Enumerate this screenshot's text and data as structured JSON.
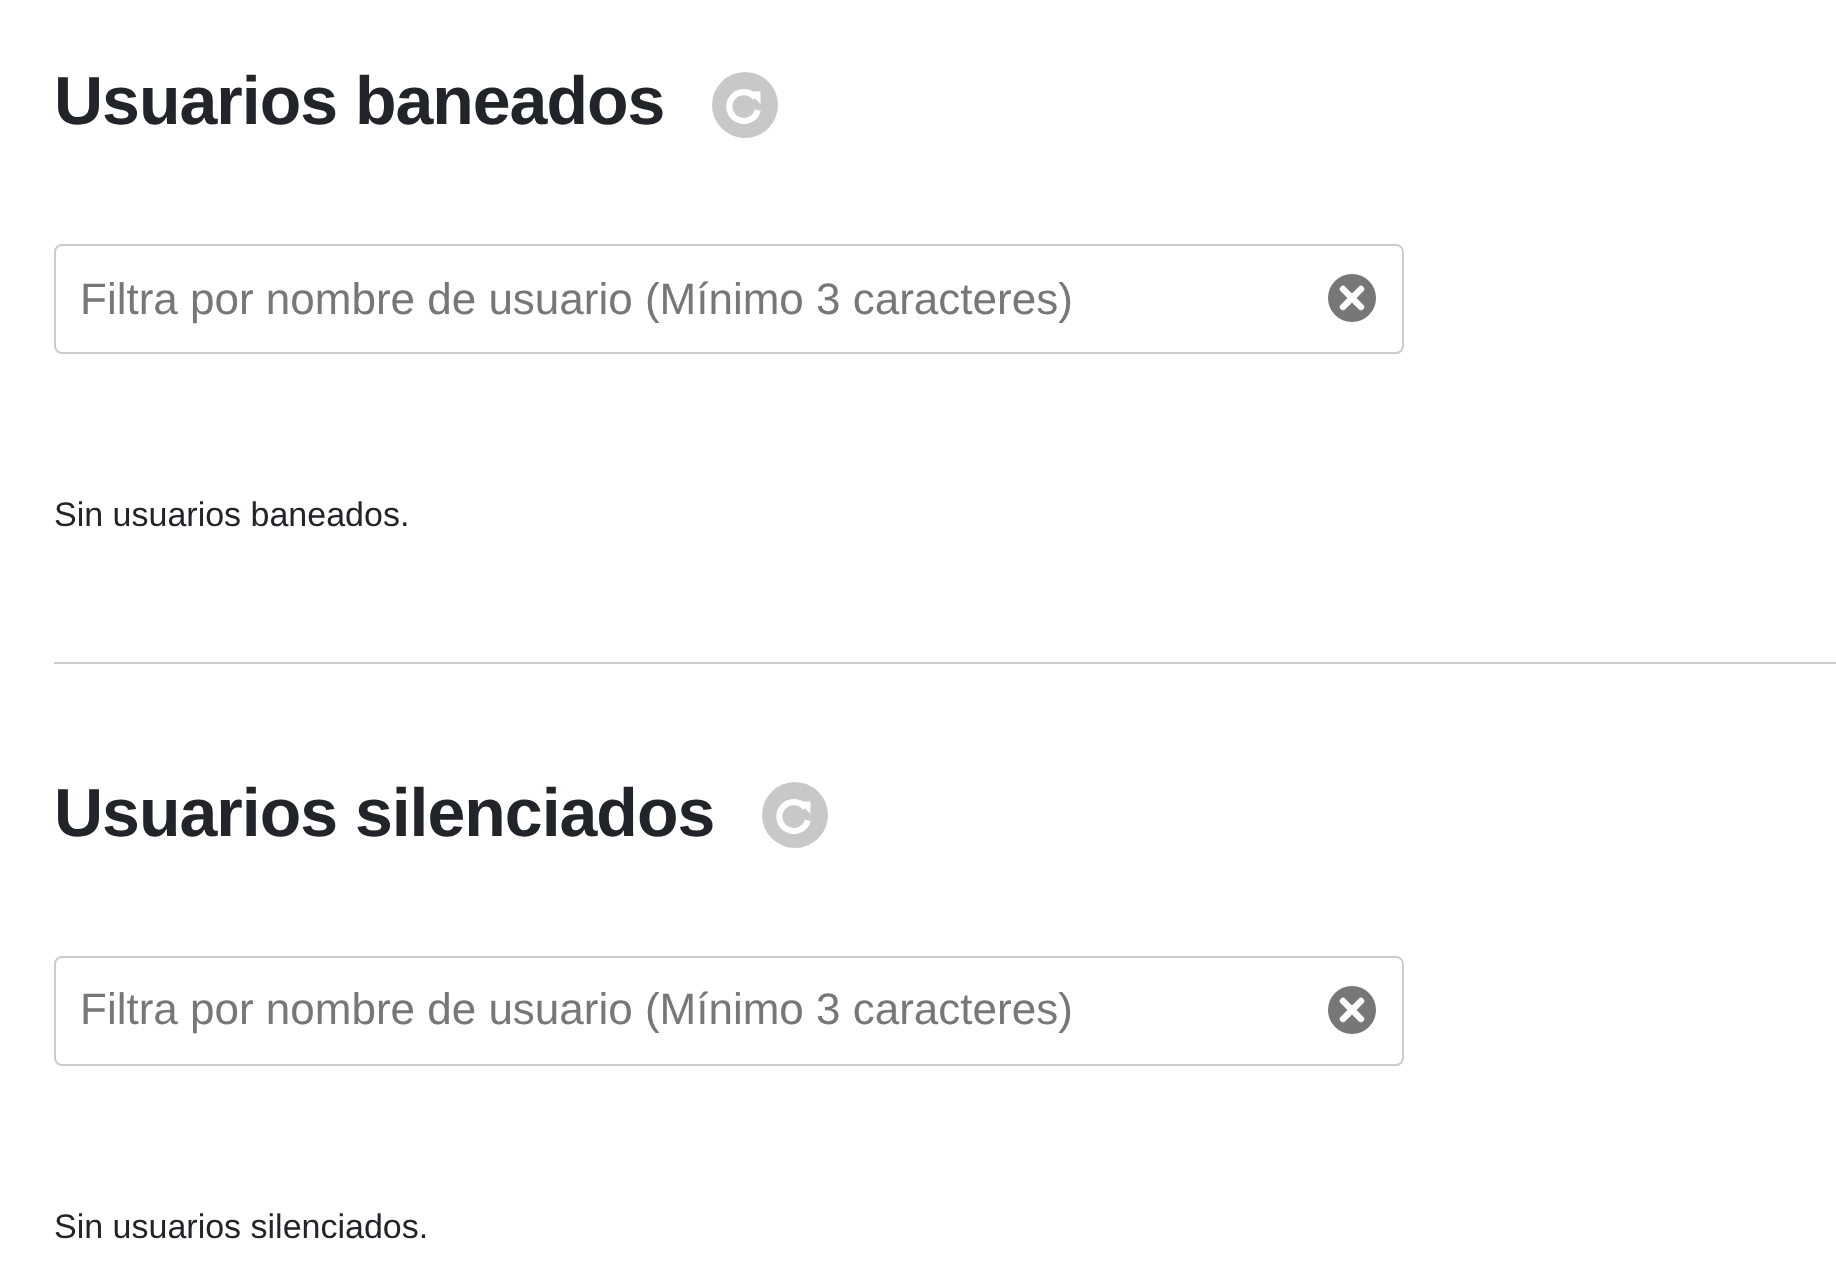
{
  "sections": [
    {
      "title": "Usuarios baneados",
      "filter": {
        "placeholder": "Filtra por nombre de usuario (Mínimo 3 caracteres)"
      },
      "empty_message": "Sin usuarios baneados."
    },
    {
      "title": "Usuarios silenciados",
      "filter": {
        "placeholder": "Filtra por nombre de usuario (Mínimo 3 caracteres)"
      },
      "empty_message": "Sin usuarios silenciados."
    }
  ]
}
